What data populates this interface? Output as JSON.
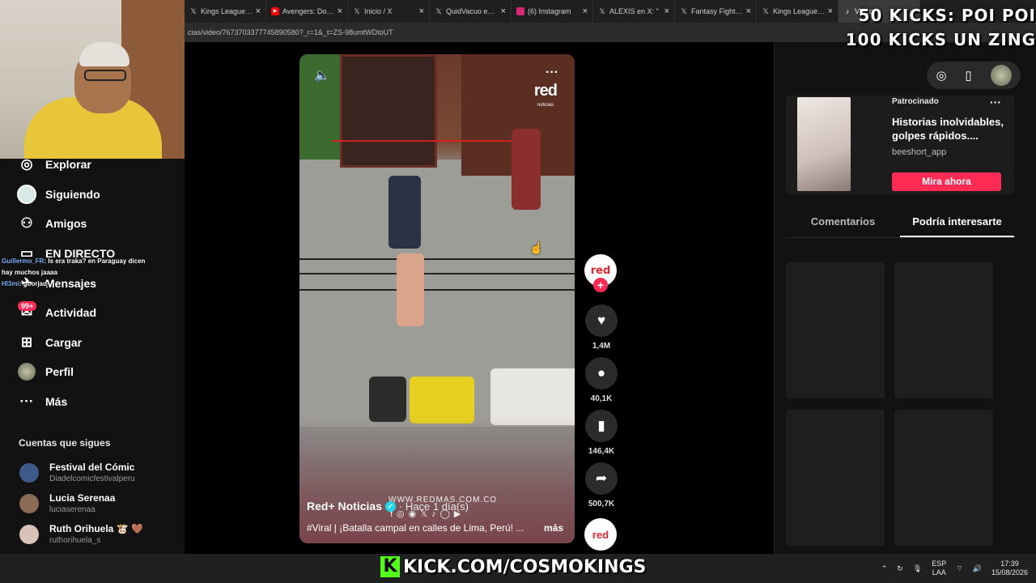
{
  "browser": {
    "tabs": [
      {
        "title": "Kings League Op",
        "icon": "x-logo-icon",
        "active": false
      },
      {
        "title": "Avengers: Dooms",
        "icon": "youtube-icon",
        "active": false
      },
      {
        "title": "Inicio / X",
        "icon": "x-logo-icon",
        "active": false
      },
      {
        "title": "QuidVacuo en X:",
        "icon": "x-logo-icon",
        "active": false
      },
      {
        "title": "(6) Instagram",
        "icon": "instagram-icon",
        "active": false
      },
      {
        "title": "ALEXIS en X: \"",
        "icon": "x-logo-icon",
        "active": false
      },
      {
        "title": "Fantasy Fight Nig",
        "icon": "x-logo-icon",
        "active": false
      },
      {
        "title": "Kings League Op",
        "icon": "x-logo-icon",
        "active": false
      },
      {
        "title": "Video",
        "icon": "tiktok-icon",
        "active": true
      }
    ],
    "url": "cias/video/7673703377745890580?_r=1&_t=ZS-98umtWDtoUT"
  },
  "overlay": {
    "kicks_line1": "50 KICKS: POI POI",
    "kicks_line2": "100 KICKS UN ZING",
    "banner": "KICK.COM/COSMOKINGS"
  },
  "chat": {
    "line1_user": "Guillermo_FR",
    "line1_text": ": Is era traka? en Paraguay dicen",
    "line2_text": "hay muchos jaaaa",
    "line3_user": "Hl3mi",
    "line3_text": ": goorjad"
  },
  "sidebar": {
    "items": [
      {
        "label": "Explorar",
        "icon": "compass-icon"
      },
      {
        "label": "Siguiendo",
        "icon": "following-icon"
      },
      {
        "label": "Amigos",
        "icon": "friends-icon"
      },
      {
        "label": "EN DIRECTO",
        "icon": "live-icon"
      },
      {
        "label": "Mensajes",
        "icon": "messages-icon"
      },
      {
        "label": "Actividad",
        "icon": "activity-icon"
      },
      {
        "label": "Cargar",
        "icon": "upload-icon"
      },
      {
        "label": "Perfil",
        "icon": "profile-icon"
      },
      {
        "label": "Más",
        "icon": "more-icon"
      }
    ],
    "activity_badge": "99+",
    "following_title": "Cuentas que sigues",
    "following": [
      {
        "name": "Festival del Cómic",
        "handle": "Diadelcomicfestivalperu",
        "color": "#3d5a8a"
      },
      {
        "name": "Lucia Serenaa",
        "handle": "luciaserenaa",
        "color": "#8a6b55"
      },
      {
        "name": "Ruth Orihuela 🐮 🤎",
        "handle": "ruthorihuela_s",
        "color": "#d9c2b8"
      }
    ]
  },
  "video": {
    "brand_logo": "red",
    "brand_sub": "noticias",
    "watermark": "WWW.REDMAS.COM.CO",
    "author": "Red+ Noticias",
    "post_time": "· Hace 1 día(s)",
    "caption": "#Viral | ¡Batalla campal en calles de Lima, Perú! ...",
    "more_label": "más"
  },
  "actions": {
    "avatar_label": "red",
    "follow_label": "+",
    "likes": "1,4M",
    "comments": "40,1K",
    "saves": "146,4K",
    "shares": "500,7K"
  },
  "right_panel": {
    "ad": {
      "sponsored": "Patrocinado",
      "title": "Historias inolvidables, golpes rápidos....",
      "handle": "beeshort_app",
      "cta": "Mira ahora"
    },
    "tabs": [
      {
        "label": "Comentarios",
        "active": false
      },
      {
        "label": "Podría interesarte",
        "active": true
      }
    ]
  },
  "taskbar": {
    "lang_top": "ESP",
    "lang_bottom": "LAA",
    "time": "17:39",
    "date": "15/08/2026"
  },
  "colors": {
    "accent": "#fe2c55",
    "kick_green": "#53fc18",
    "verified": "#20d5ec"
  }
}
